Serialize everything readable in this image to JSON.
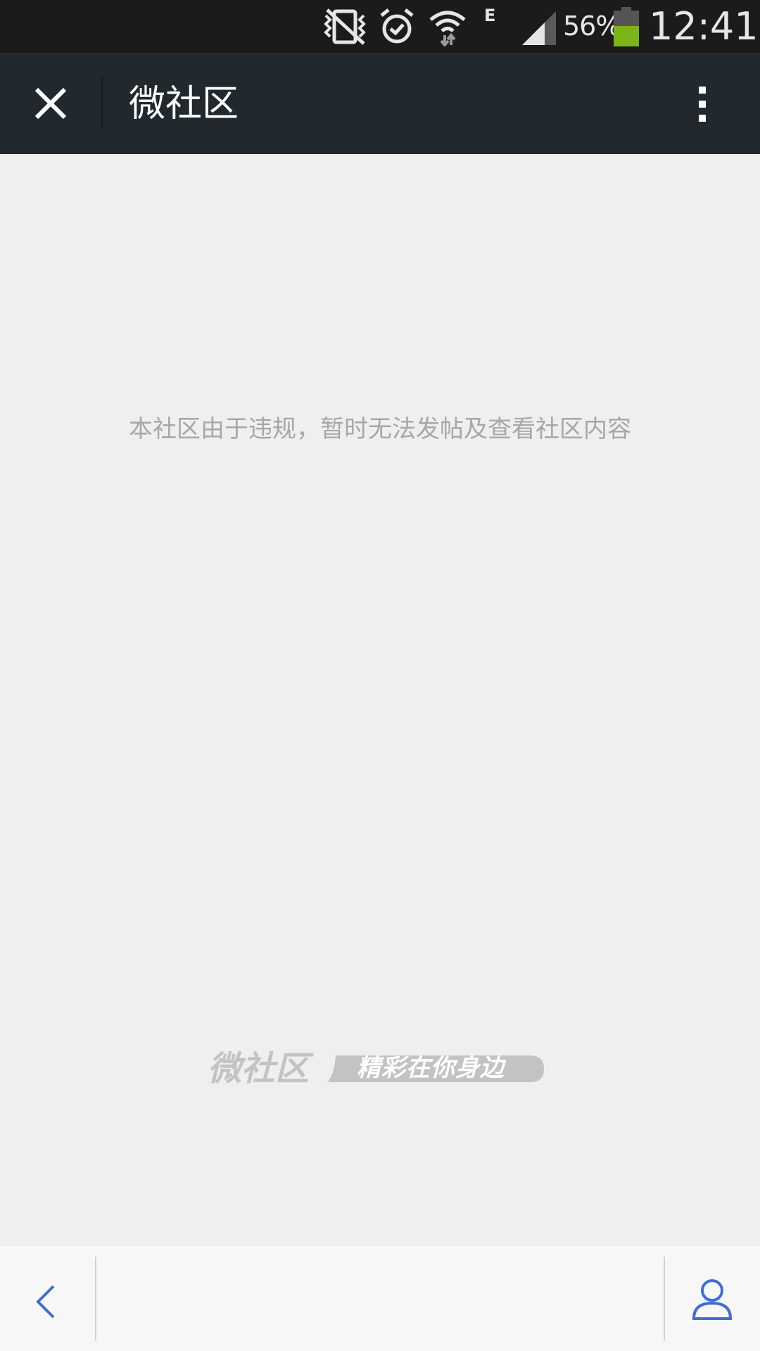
{
  "status_bar": {
    "battery_percent": "56%",
    "time": "12:41",
    "network_type": "E",
    "icons": [
      "vibrate-off-icon",
      "alarm-icon",
      "wifi-icon",
      "signal-icon",
      "battery-icon"
    ],
    "battery_level": 0.56,
    "battery_color": "#7cb518"
  },
  "title_bar": {
    "title": "微社区",
    "close_icon": "close-icon",
    "more_icon": "more-vertical-icon"
  },
  "content": {
    "notice": "本社区由于违规，暂时无法发帖及查看社区内容",
    "brand_name": "微社区",
    "brand_slogan": "精彩在你身边"
  },
  "bottom_bar": {
    "back_icon": "chevron-left-icon",
    "profile_icon": "user-icon",
    "accent_color": "#3f6fd0"
  }
}
